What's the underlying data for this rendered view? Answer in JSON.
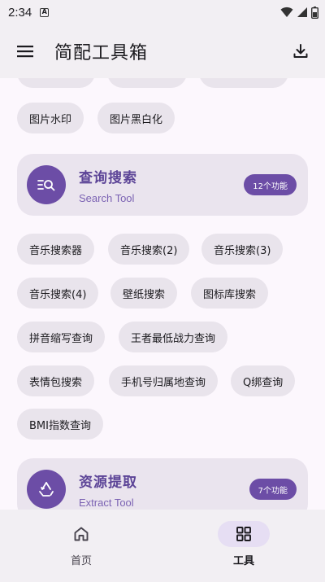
{
  "status_bar": {
    "time": "2:34",
    "badge": "A"
  },
  "app_bar": {
    "title": "简配工具箱"
  },
  "image_chips": [
    "图片水印",
    "图片黑白化"
  ],
  "search_category": {
    "title": "查询搜索",
    "subtitle": "Search Tool",
    "badge": "12个功能"
  },
  "search_tools": [
    "音乐搜索器",
    "音乐搜索(2)",
    "音乐搜索(3)",
    "音乐搜索(4)",
    "壁纸搜索",
    "图标库搜索",
    "拼音缩写查询",
    "王者最低战力查询",
    "表情包搜索",
    "手机号归属地查询",
    "Q绑查询",
    "BMI指数查询"
  ],
  "extract_category": {
    "title": "资源提取",
    "subtitle": "Extract Tool",
    "badge": "7个功能"
  },
  "bottom_nav": {
    "home_label": "首页",
    "tools_label": "工具"
  },
  "colors": {
    "accent": "#6C4DA6",
    "chip_bg": "#E9E4EC",
    "card_bg": "#EAE4EE",
    "bar_bg": "#F2EFF3",
    "nav_active": "#E6DEF3"
  },
  "icons": {
    "menu": "hamburger-icon",
    "download": "download-icon",
    "search_category": "search-list-icon",
    "extract_category": "extract-recycle-icon",
    "home": "home-icon",
    "tools": "grid-icon"
  }
}
